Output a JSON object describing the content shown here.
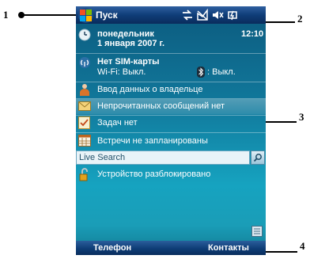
{
  "annotations": [
    "1",
    "2",
    "3",
    "4"
  ],
  "titlebar": {
    "start_label": "Пуск",
    "icons": [
      "connectivity-icon",
      "no-signal-icon",
      "volume-muted-icon",
      "battery-charging-icon"
    ]
  },
  "today": {
    "date_line1": "понедельник",
    "date_line2": "1 января 2007 г.",
    "time": "12:10",
    "connection_title": "Нет SIM-карты",
    "wifi_status": "Wi-Fi: Выкл.",
    "bluetooth_status": ": Выкл.",
    "owner": "Ввод данных о владельце",
    "messages": "Непрочитанных сообщений нет",
    "tasks": "Задач нет",
    "calendar": "Встречи не запланированы",
    "search_label": "Live Search",
    "lock_status": "Устройство разблокировано"
  },
  "softkeys": {
    "left": "Телефон",
    "right": "Контакты"
  }
}
